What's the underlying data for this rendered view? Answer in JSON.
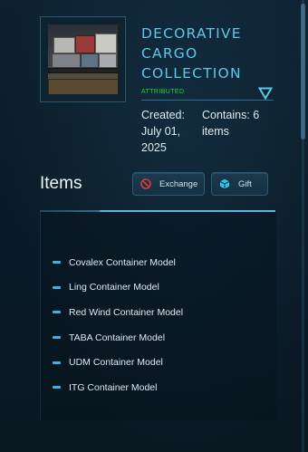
{
  "collection": {
    "title_lines": [
      "DECORATIVE",
      "CARGO",
      "COLLECTION"
    ],
    "status": "ATTRIBUTED",
    "created_label": "Created:",
    "created_value_line1": "July 01,",
    "created_value_line2": "2025",
    "contains_label": "Contains: 6",
    "contains_value": "items"
  },
  "items_section": {
    "heading": "Items",
    "exchange_label": "Exchange",
    "gift_label": "Gift",
    "items": [
      "Covalex Container Model",
      "Ling Container Model",
      "Red Wind Container Model",
      "TABA Container Model",
      "UDM Container Model",
      "ITG Container Model"
    ]
  },
  "colors": {
    "accent": "#5fc6e8",
    "status_green": "#27d43b",
    "bullet": "#3fb2e4",
    "exchange_icon": "#d93a3a",
    "gift_icon": "#36c0e6"
  },
  "icons": {
    "expand": "triangle-down-icon",
    "exchange": "no-entry-icon",
    "gift": "cube-icon"
  }
}
